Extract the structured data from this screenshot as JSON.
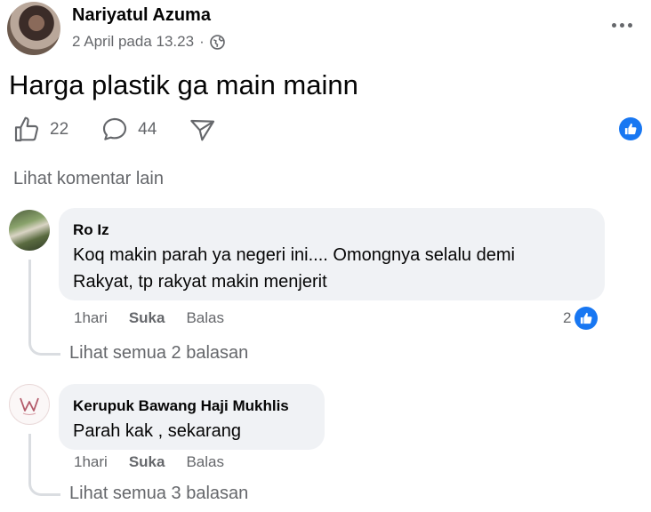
{
  "post": {
    "author": "Nariyatul Azuma",
    "date": "2 April pada 13.23",
    "separator": "·",
    "privacy_icon": "globe-icon",
    "text": "Harga plastik ga main mainn",
    "likes": "22",
    "comments": "44",
    "reaction_icon": "like-reaction-icon"
  },
  "more_comments_label": "Lihat komentar lain",
  "comments": [
    {
      "author": "Ro Iz",
      "text_line1": "Koq makin parah ya negeri ini.... Omongnya selalu demi",
      "text_line2": "Rakyat, tp rakyat makin menjerit",
      "time": "1hari",
      "like_label": "Suka",
      "reply_label": "Balas",
      "reaction_count": "2",
      "see_replies": "Lihat semua 2 balasan"
    },
    {
      "author": "Kerupuk Bawang Haji Mukhlis",
      "text_line1": "Parah kak , sekarang",
      "time": "1hari",
      "like_label": "Suka",
      "reply_label": "Balas",
      "see_replies": "Lihat semua 3 balasan"
    }
  ],
  "colors": {
    "primary_text": "#050505",
    "secondary_text": "#65676b",
    "bubble_bg": "#f0f2f5",
    "like_blue": "#1877f2"
  }
}
